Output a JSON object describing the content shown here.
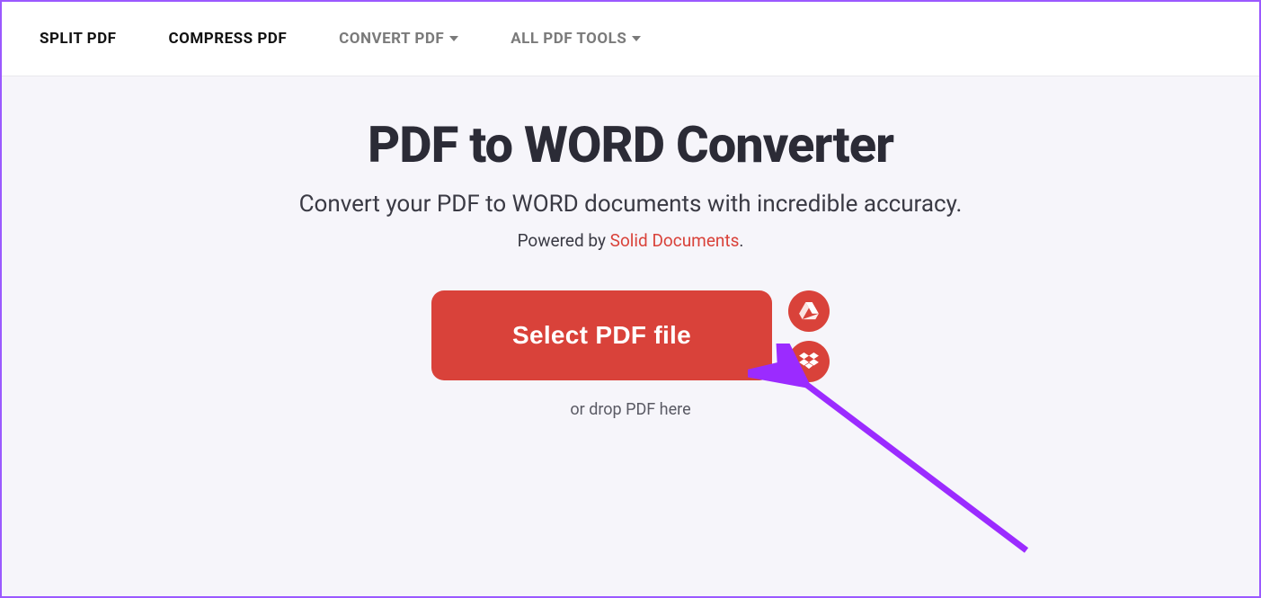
{
  "nav": {
    "split": "SPLIT PDF",
    "compress": "COMPRESS PDF",
    "convert": "CONVERT PDF",
    "all_tools": "ALL PDF TOOLS"
  },
  "hero": {
    "title": "PDF to WORD Converter",
    "subtitle": "Convert your PDF to WORD documents with incredible accuracy.",
    "powered_prefix": "Powered by ",
    "powered_link": "Solid Documents",
    "powered_suffix": "."
  },
  "upload": {
    "select_label": "Select PDF file",
    "drop_text": "or drop PDF here"
  }
}
